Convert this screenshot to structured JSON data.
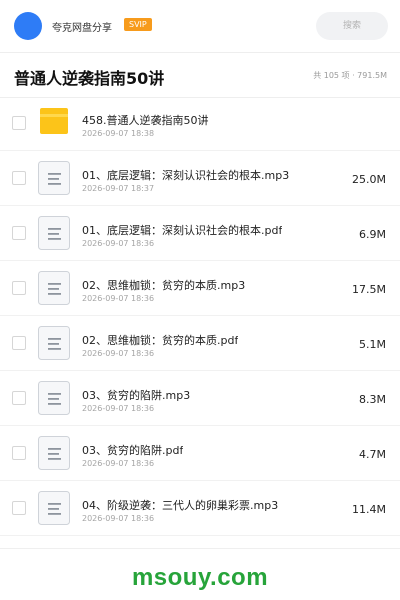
{
  "header": {
    "username": "夸克网盘分享",
    "badge": "SVIP",
    "search_placeholder": "搜索"
  },
  "folder": {
    "title": "普通人逆袭指南50讲",
    "summary": "共 105 项 · 791.5M"
  },
  "files": [
    {
      "type": "folder",
      "name": "458.普通人逆袭指南50讲",
      "date": "2026-09-07 18:38",
      "size": ""
    },
    {
      "type": "file",
      "name": "01、底层逻辑：深刻认识社会的根本.mp3",
      "date": "2026-09-07 18:37",
      "size": "25.0M"
    },
    {
      "type": "file",
      "name": "01、底层逻辑：深刻认识社会的根本.pdf",
      "date": "2026-09-07 18:36",
      "size": "6.9M"
    },
    {
      "type": "file",
      "name": "02、思维枷锁：贫穷的本质.mp3",
      "date": "2026-09-07 18:36",
      "size": "17.5M"
    },
    {
      "type": "file",
      "name": "02、思维枷锁：贫穷的本质.pdf",
      "date": "2026-09-07 18:36",
      "size": "5.1M"
    },
    {
      "type": "file",
      "name": "03、贫穷的陷阱.mp3",
      "date": "2026-09-07 18:36",
      "size": "8.3M"
    },
    {
      "type": "file",
      "name": "03、贫穷的陷阱.pdf",
      "date": "2026-09-07 18:36",
      "size": "4.7M"
    },
    {
      "type": "file",
      "name": "04、阶级逆袭：三代人的卵巢彩票.mp3",
      "date": "2026-09-07 18:36",
      "size": "11.4M"
    }
  ],
  "watermark": "msouy.com",
  "colors": {
    "avatar": "#2e7cf6",
    "badge": "#f79b1c",
    "folder": "#fcc419",
    "watermark": "#27a43a"
  }
}
